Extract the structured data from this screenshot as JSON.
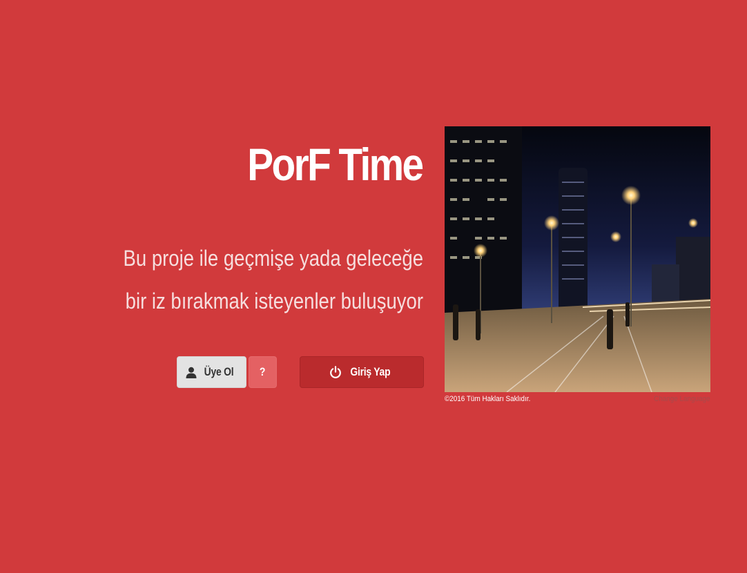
{
  "hero": {
    "title": "PorF Time",
    "tagline_line1": "Bu proje ile geçmişe yada geleceğe",
    "tagline_line2": "bir iz bırakmak isteyenler buluşuyor"
  },
  "actions": {
    "register_label": "Üye Ol",
    "register_icon": "user-icon",
    "help_label": "?",
    "login_label": "Giriş Yap",
    "login_icon": "power-icon"
  },
  "footer": {
    "copyright": "©2016 Tüm Hakları Saklıdır.",
    "language_link": "Change Language"
  },
  "colors": {
    "background": "#d13a3c",
    "login_button": "#ba2b2d",
    "register_button": "#e3e3e3",
    "help_button": "#e46163"
  }
}
